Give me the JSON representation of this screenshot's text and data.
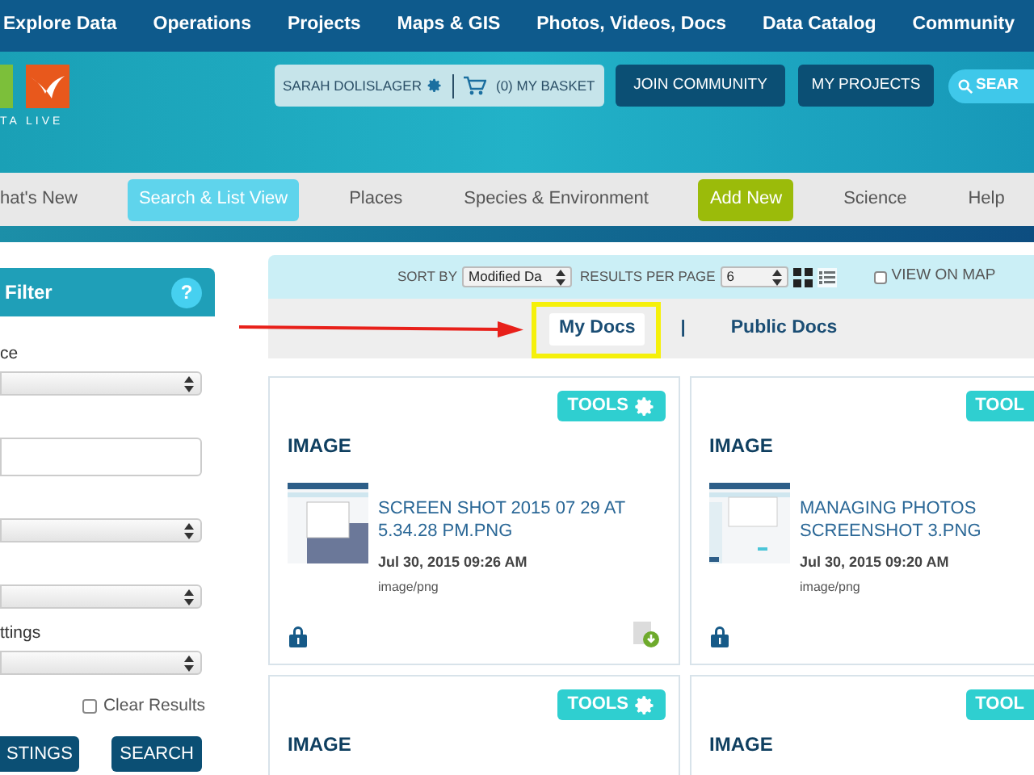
{
  "top_nav": {
    "items": [
      "Explore Data",
      "Operations",
      "Projects",
      "Maps & GIS",
      "Photos, Videos, Docs",
      "Data Catalog",
      "Community"
    ]
  },
  "header": {
    "logo_text": "TA LIVE",
    "user": "SARAH DOLISLAGER",
    "basket": "(0) MY BASKET",
    "buttons": [
      "JOIN COMMUNITY",
      "MY PROJECTS"
    ],
    "search_button": "SEAR"
  },
  "sub_nav": {
    "items": [
      {
        "label": "hat's New",
        "kind": "link",
        "selected": false
      },
      {
        "label": "Search & List View",
        "kind": "link",
        "selected": true
      },
      {
        "label": "Places",
        "kind": "link",
        "selected": false
      },
      {
        "label": "Species & Environment",
        "kind": "link",
        "selected": false
      },
      {
        "label": "Add New",
        "kind": "action",
        "selected": false
      },
      {
        "label": "Science",
        "kind": "link",
        "selected": false
      },
      {
        "label": "Help",
        "kind": "link",
        "selected": false
      }
    ]
  },
  "filter": {
    "title": "Filter",
    "help": "?",
    "fields": [
      {
        "kind": "select",
        "label": "ce"
      },
      {
        "kind": "text"
      },
      {
        "kind": "select"
      },
      {
        "kind": "select"
      },
      {
        "kind": "select",
        "label": "ttings"
      }
    ],
    "clear_results": {
      "label": "Clear Results",
      "checked": false
    },
    "buttons": [
      "STINGS",
      "SEARCH"
    ]
  },
  "toolbar": {
    "sort_by_label": "SORT BY",
    "sort_by_value": "Modified Da",
    "per_page_label": "RESULTS PER PAGE",
    "per_page_value": "6",
    "views": [
      {
        "kind": "grid",
        "selected": true
      },
      {
        "kind": "list",
        "selected": false
      }
    ],
    "view_on_map": {
      "label": "VIEW ON MAP",
      "checked": false
    }
  },
  "doc_tabs": {
    "separator": "|",
    "tabs": [
      {
        "label": "My Docs",
        "selected": true
      },
      {
        "label": "Public Docs",
        "selected": false
      }
    ]
  },
  "cards": [
    {
      "type": "IMAGE",
      "tools": "TOOLS",
      "title": "SCREEN SHOT 2015 07 29 AT 5.34.28 PM.PNG",
      "date": "Jul 30, 2015 09:26 AM",
      "mime": "image/png",
      "locked": true,
      "download": true
    },
    {
      "type": "IMAGE",
      "tools": "TOOL",
      "title": "MANAGING PHOTOS SCREENSHOT 3.PNG",
      "date": "Jul 30, 2015 09:20 AM",
      "mime": "image/png",
      "locked": true,
      "download": false
    },
    {
      "type": "IMAGE",
      "tools": "TOOLS"
    },
    {
      "type": "IMAGE",
      "tools": "TOOL"
    }
  ]
}
